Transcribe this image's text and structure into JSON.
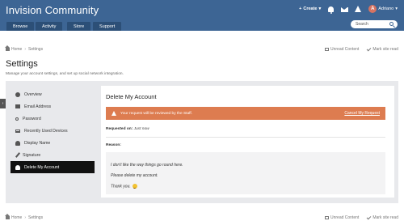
{
  "header": {
    "site_title": "Invision Community",
    "create_label": "Create",
    "create_chevron": "▾",
    "username": "Adriano",
    "avatar_letter": "A",
    "user_chevron": "▾"
  },
  "nav": {
    "tabs": [
      {
        "label": "Browse"
      },
      {
        "label": "Activity"
      },
      {
        "label": "Store"
      },
      {
        "label": "Support"
      }
    ],
    "search_placeholder": "Search"
  },
  "breadcrumb": {
    "home": "Home",
    "separator": "›",
    "current": "Settings",
    "unread": "Unread Content",
    "mark_read": "Mark site read"
  },
  "page": {
    "title": "Settings",
    "description": "Manage your account settings, and set up social network integration."
  },
  "side_toggle": "›",
  "menu": {
    "items": [
      {
        "label": "Overview",
        "icon": "user-circle-icon"
      },
      {
        "label": "Email Address",
        "icon": "envelope-icon"
      },
      {
        "label": "Password",
        "icon": "key-icon"
      },
      {
        "label": "Recently Used Devices",
        "icon": "laptop-icon"
      },
      {
        "label": "Display Name",
        "icon": "user-icon"
      },
      {
        "label": "Signature",
        "icon": "pen-icon"
      },
      {
        "label": "Delete My Account",
        "icon": "user-icon",
        "active": true
      }
    ]
  },
  "card": {
    "title": "Delete My Account",
    "alert_text": "Your request will be reviewed by the Staff.",
    "cancel_label": "Cancel My Request",
    "requested_label": "Requested on:",
    "requested_value": "Just now",
    "reason_label": "Reason:",
    "reason_lines": [
      "I don't like the way things go round here.",
      "Please delete my account.",
      "Thank you."
    ]
  },
  "colors": {
    "header": "#3d6594",
    "nav_tab": "#2c4f77",
    "alert": "#dd7c50",
    "active_menu": "#111111",
    "panel": "#e8e9ec"
  }
}
